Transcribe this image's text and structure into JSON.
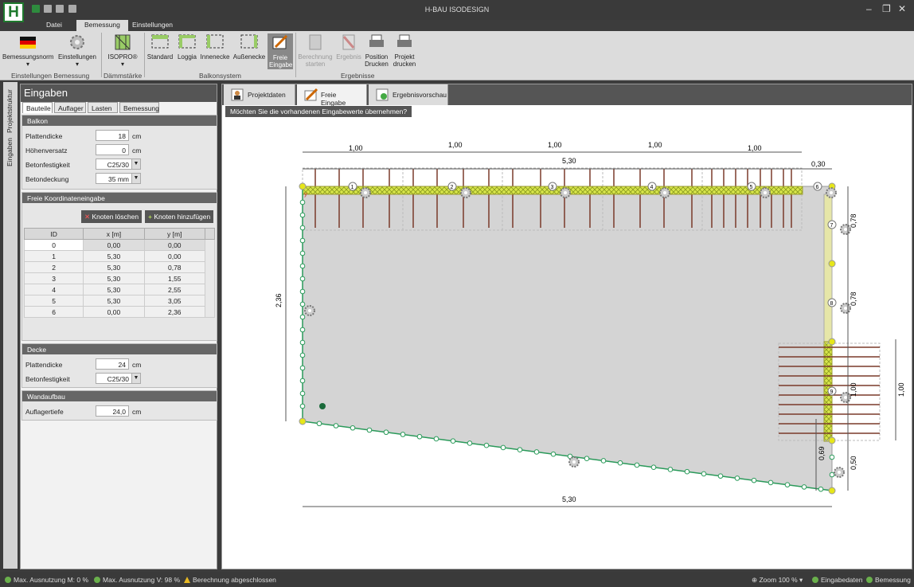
{
  "app": {
    "title": "H-BAU ISODESIGN",
    "logo_letter": "H"
  },
  "menu_tabs": [
    "Datei",
    "Bemessung",
    "Einstellungen"
  ],
  "ribbon": {
    "buttons": [
      {
        "label": "Bemessungsnorm",
        "icon": "flag-de-icon"
      },
      {
        "label": "Einstellungen",
        "icon": "gear-icon"
      },
      {
        "label": "ISOPRO®",
        "icon": "isopro-icon"
      },
      {
        "label": "Standard",
        "icon": "balcony-standard-icon"
      },
      {
        "label": "Loggia",
        "icon": "balcony-loggia-icon"
      },
      {
        "label": "Innenecke",
        "icon": "balcony-innenecke-icon"
      },
      {
        "label": "Außenecke",
        "icon": "balcony-aussenecke-icon"
      },
      {
        "label": "Freie Eingabe",
        "icon": "free-input-icon"
      },
      {
        "label": "Berechnung starten",
        "icon": "calculator-icon"
      },
      {
        "label": "Ergebnis",
        "icon": "result-icon"
      },
      {
        "label": "Position Drucken",
        "icon": "printer-icon"
      },
      {
        "label": "Projekt drucken",
        "icon": "printer-icon"
      }
    ],
    "groups": [
      "Einstellungen Bemessung",
      "Dämmstärke",
      "Balkonsystem",
      "Ergebnisse"
    ]
  },
  "side_tabs": [
    "Projektstruktur",
    "Eingaben"
  ],
  "panel": {
    "title": "Eingaben",
    "subtabs": [
      "Bauteile",
      "Auflager",
      "Lasten",
      "Bemessung"
    ],
    "balkon": {
      "header": "Balkon",
      "plattendicke_label": "Plattendicke",
      "plattendicke_value": "18",
      "plattendicke_unit": "cm",
      "hoehenversatz_label": "Höhenversatz",
      "hoehenversatz_value": "0",
      "hoehenversatz_unit": "cm",
      "betonfestigkeit_label": "Betonfestigkeit",
      "betonfestigkeit_value": "C25/30",
      "betondeckung_label": "Betondeckung",
      "betondeckung_value": "35 mm"
    },
    "koordinaten": {
      "header": "Freie Koordinateneingabe",
      "delete_label": "Knoten löschen",
      "add_label": "Knoten hinzufügen",
      "columns": [
        "ID",
        "x [m]",
        "y [m]"
      ],
      "rows": [
        [
          "0",
          "0,00",
          "0,00"
        ],
        [
          "1",
          "5,30",
          "0,00"
        ],
        [
          "2",
          "5,30",
          "0,78"
        ],
        [
          "3",
          "5,30",
          "1,55"
        ],
        [
          "4",
          "5,30",
          "2,55"
        ],
        [
          "5",
          "5,30",
          "3,05"
        ],
        [
          "6",
          "0,00",
          "2,36"
        ]
      ]
    },
    "decke": {
      "header": "Decke",
      "plattendicke_label": "Plattendicke",
      "plattendicke_value": "24",
      "plattendicke_unit": "cm",
      "betonfestigkeit_label": "Betonfestigkeit",
      "betonfestigkeit_value": "C25/30"
    },
    "wandaufbau": {
      "header": "Wandaufbau",
      "auflagertiefe_label": "Auflagertiefe",
      "auflagertiefe_value": "24,0",
      "auflagertiefe_unit": "cm"
    }
  },
  "canvas": {
    "tabs": [
      "Projektdaten",
      "Freie Eingabe",
      "Ergebnisvorschau"
    ],
    "hint": "Möchten Sie die vorhandenen Eingabewerte übernehmen?",
    "dimensions": {
      "segments": [
        "1,00",
        "1,00",
        "1,00",
        "1,00",
        "1,00"
      ],
      "total_top": "5,30",
      "right_top": "0,30",
      "left": "2,36",
      "bottom": "5,30",
      "right_78a": "0,78",
      "right_78b": "0,78",
      "right_100": "1,00",
      "right_outer_100": "1,00",
      "right_069": "0,69",
      "right_050": "0,50"
    },
    "node_labels": [
      "1",
      "2",
      "3",
      "4",
      "5",
      "6",
      "7",
      "8",
      "9"
    ],
    "y_axis_label": "y"
  },
  "statusbar": {
    "max_m": "Max. Ausnutzung M: 0 %",
    "max_v": "Max. Ausnutzung V: 98 %",
    "calc": "Berechnung abgeschlossen",
    "zoom": "Zoom 100 %",
    "eingabedaten": "Eingabedaten",
    "bemessung": "Bemessung"
  }
}
